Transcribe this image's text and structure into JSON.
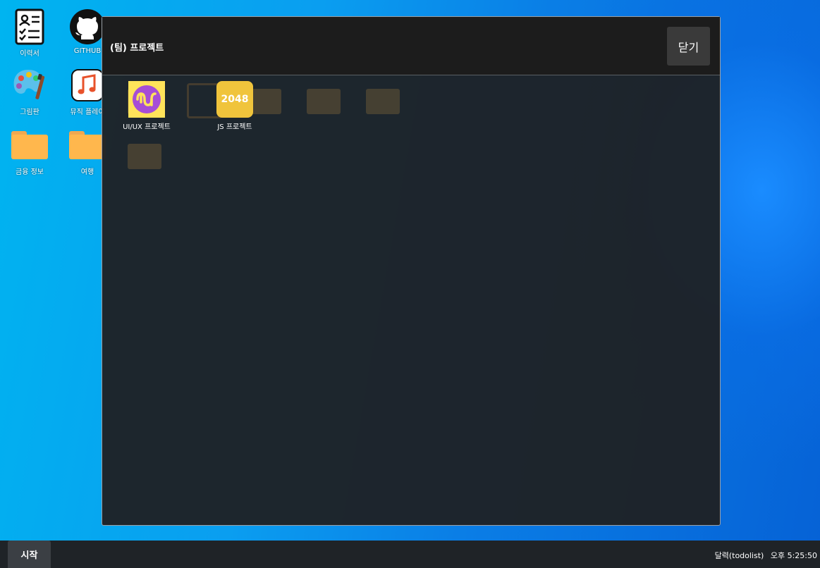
{
  "desktop": {
    "icons": [
      {
        "label": "이력서",
        "icon": "resume-icon"
      },
      {
        "label": "GITHUB",
        "icon": "github-icon"
      },
      {
        "label": "그림판",
        "icon": "paint-palette-icon"
      },
      {
        "label": "뮤직 플레이",
        "icon": "music-note-icon"
      },
      {
        "label": "금융 정보",
        "icon": "folder-icon"
      },
      {
        "label": "여행",
        "icon": "folder-icon"
      }
    ]
  },
  "modal": {
    "title": "(팀) 프로젝트",
    "close_label": "닫기",
    "items": [
      {
        "label": "UI/UX 프로젝트",
        "icon": "uiux-wave-icon"
      },
      {
        "label": "JS 프로젝트",
        "icon": "game-2048-icon",
        "icon_text": "2048"
      }
    ]
  },
  "taskbar": {
    "start_label": "시작",
    "app_label": "달력(todolist)",
    "clock": "오후 5:25:50"
  },
  "colors": {
    "folder": "#ffb74d",
    "uiux_bg": "#ffe35a",
    "uiux_circle": "#a64dd6",
    "js_bg": "#f0c43c"
  }
}
